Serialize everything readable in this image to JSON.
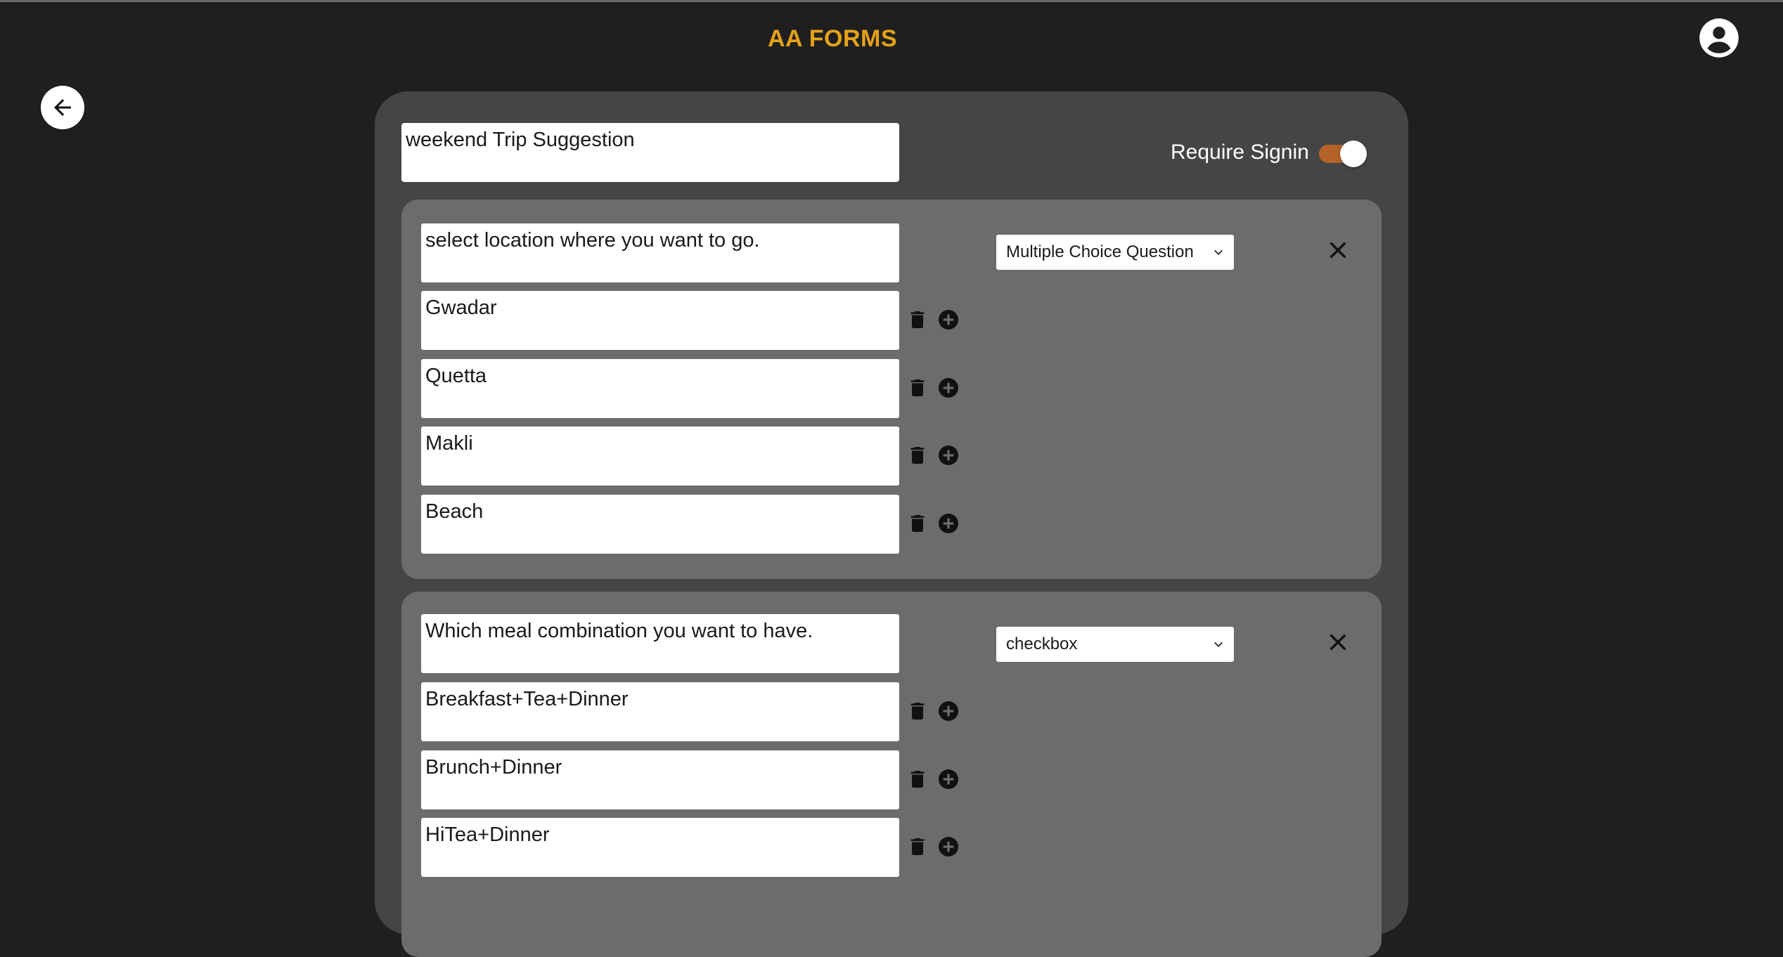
{
  "app": {
    "title": "AA FORMS"
  },
  "form": {
    "title_value": "weekend Trip Suggestion",
    "require_signin_label": "Require Signin",
    "require_signin_on": true,
    "questions": [
      {
        "text": "select location where you want to go.",
        "type": "Multiple Choice Question",
        "options": [
          "Gwadar",
          "Quetta",
          "Makli",
          "Beach"
        ]
      },
      {
        "text": "Which meal combination you want to have.",
        "type": "checkbox",
        "options": [
          "Breakfast+Tea+Dinner",
          "Brunch+Dinner",
          "HiTea+Dinner"
        ]
      }
    ]
  },
  "icons": {
    "back": "arrow-left-icon",
    "profile": "account-circle-icon",
    "close": "close-icon",
    "delete": "trash-icon",
    "add": "plus-circle-icon",
    "dropdown": "chevron-down-icon"
  },
  "colors": {
    "background": "#1f1f1f",
    "title": "#e4a11b",
    "card": "#444547",
    "question_card": "#6b6c6e",
    "toggle_track": "#b5622a"
  }
}
